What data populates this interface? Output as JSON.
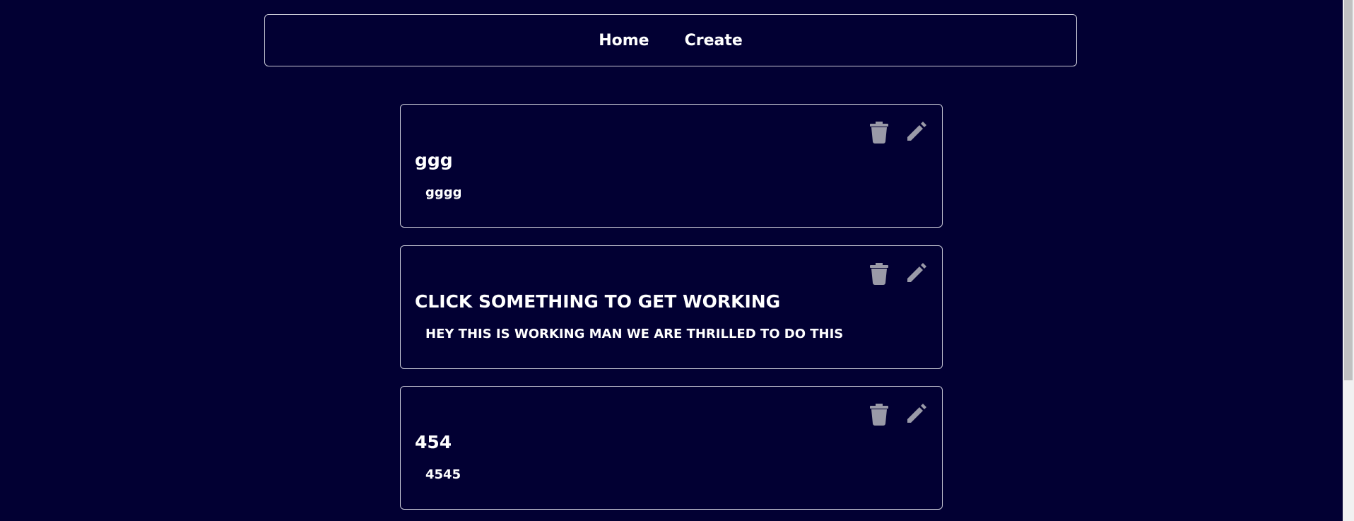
{
  "nav": {
    "home_label": "Home",
    "create_label": "Create"
  },
  "cards": [
    {
      "title": "ggg",
      "body": "gggg"
    },
    {
      "title": "CLICK SOMETHING TO GET WORKING",
      "body": "HEY THIS IS WORKING MAN WE ARE THRILLED TO DO THIS"
    },
    {
      "title": "454",
      "body": "4545"
    }
  ],
  "icons": {
    "delete": "trash-icon",
    "edit": "pencil-icon"
  },
  "colors": {
    "background": "#020033",
    "border": "#c9c9d6",
    "icon": "#9a9aa8",
    "text": "#ffffff"
  }
}
